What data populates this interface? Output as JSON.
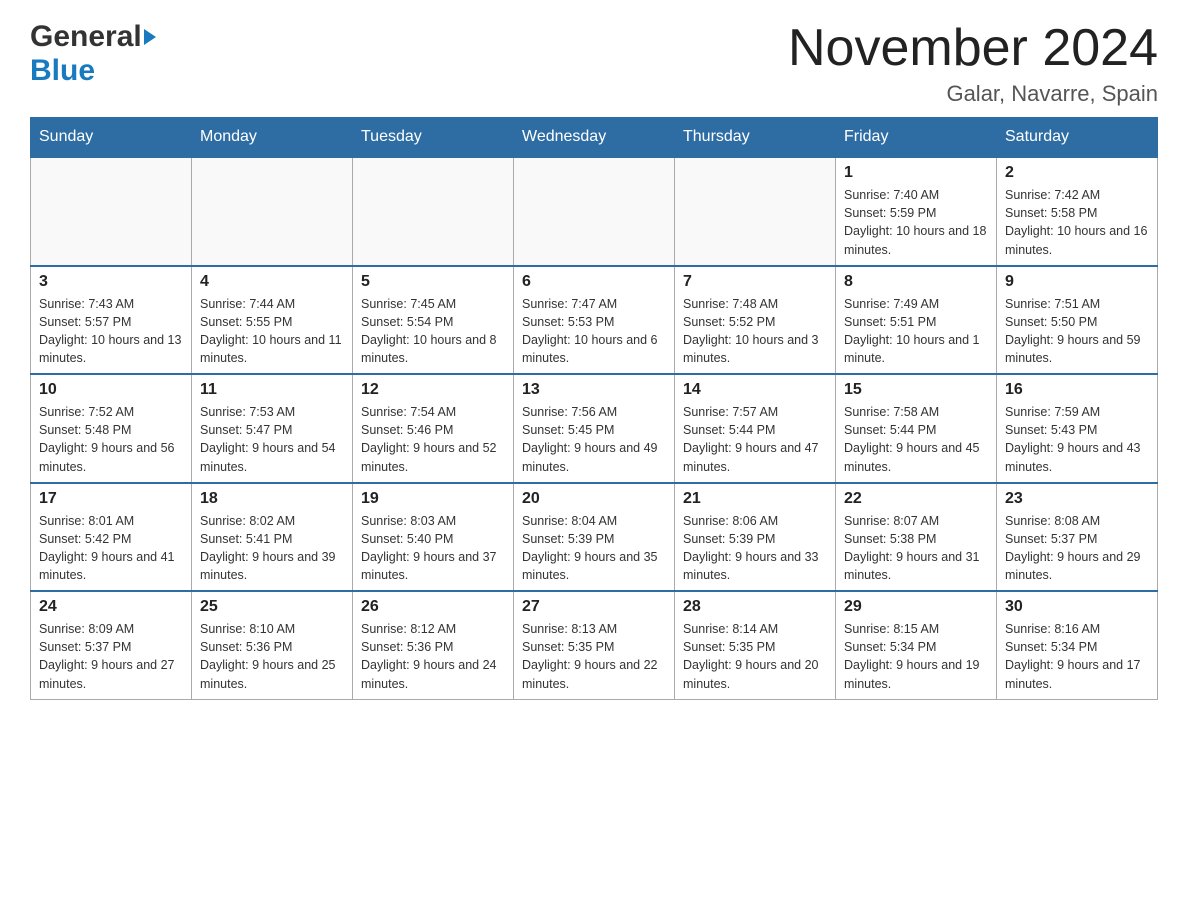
{
  "header": {
    "logo_general": "General",
    "logo_blue": "Blue",
    "month_title": "November 2024",
    "location": "Galar, Navarre, Spain"
  },
  "calendar": {
    "days_of_week": [
      "Sunday",
      "Monday",
      "Tuesday",
      "Wednesday",
      "Thursday",
      "Friday",
      "Saturday"
    ],
    "weeks": [
      {
        "days": [
          {
            "number": "",
            "info": ""
          },
          {
            "number": "",
            "info": ""
          },
          {
            "number": "",
            "info": ""
          },
          {
            "number": "",
            "info": ""
          },
          {
            "number": "",
            "info": ""
          },
          {
            "number": "1",
            "info": "Sunrise: 7:40 AM\nSunset: 5:59 PM\nDaylight: 10 hours and 18 minutes."
          },
          {
            "number": "2",
            "info": "Sunrise: 7:42 AM\nSunset: 5:58 PM\nDaylight: 10 hours and 16 minutes."
          }
        ]
      },
      {
        "days": [
          {
            "number": "3",
            "info": "Sunrise: 7:43 AM\nSunset: 5:57 PM\nDaylight: 10 hours and 13 minutes."
          },
          {
            "number": "4",
            "info": "Sunrise: 7:44 AM\nSunset: 5:55 PM\nDaylight: 10 hours and 11 minutes."
          },
          {
            "number": "5",
            "info": "Sunrise: 7:45 AM\nSunset: 5:54 PM\nDaylight: 10 hours and 8 minutes."
          },
          {
            "number": "6",
            "info": "Sunrise: 7:47 AM\nSunset: 5:53 PM\nDaylight: 10 hours and 6 minutes."
          },
          {
            "number": "7",
            "info": "Sunrise: 7:48 AM\nSunset: 5:52 PM\nDaylight: 10 hours and 3 minutes."
          },
          {
            "number": "8",
            "info": "Sunrise: 7:49 AM\nSunset: 5:51 PM\nDaylight: 10 hours and 1 minute."
          },
          {
            "number": "9",
            "info": "Sunrise: 7:51 AM\nSunset: 5:50 PM\nDaylight: 9 hours and 59 minutes."
          }
        ]
      },
      {
        "days": [
          {
            "number": "10",
            "info": "Sunrise: 7:52 AM\nSunset: 5:48 PM\nDaylight: 9 hours and 56 minutes."
          },
          {
            "number": "11",
            "info": "Sunrise: 7:53 AM\nSunset: 5:47 PM\nDaylight: 9 hours and 54 minutes."
          },
          {
            "number": "12",
            "info": "Sunrise: 7:54 AM\nSunset: 5:46 PM\nDaylight: 9 hours and 52 minutes."
          },
          {
            "number": "13",
            "info": "Sunrise: 7:56 AM\nSunset: 5:45 PM\nDaylight: 9 hours and 49 minutes."
          },
          {
            "number": "14",
            "info": "Sunrise: 7:57 AM\nSunset: 5:44 PM\nDaylight: 9 hours and 47 minutes."
          },
          {
            "number": "15",
            "info": "Sunrise: 7:58 AM\nSunset: 5:44 PM\nDaylight: 9 hours and 45 minutes."
          },
          {
            "number": "16",
            "info": "Sunrise: 7:59 AM\nSunset: 5:43 PM\nDaylight: 9 hours and 43 minutes."
          }
        ]
      },
      {
        "days": [
          {
            "number": "17",
            "info": "Sunrise: 8:01 AM\nSunset: 5:42 PM\nDaylight: 9 hours and 41 minutes."
          },
          {
            "number": "18",
            "info": "Sunrise: 8:02 AM\nSunset: 5:41 PM\nDaylight: 9 hours and 39 minutes."
          },
          {
            "number": "19",
            "info": "Sunrise: 8:03 AM\nSunset: 5:40 PM\nDaylight: 9 hours and 37 minutes."
          },
          {
            "number": "20",
            "info": "Sunrise: 8:04 AM\nSunset: 5:39 PM\nDaylight: 9 hours and 35 minutes."
          },
          {
            "number": "21",
            "info": "Sunrise: 8:06 AM\nSunset: 5:39 PM\nDaylight: 9 hours and 33 minutes."
          },
          {
            "number": "22",
            "info": "Sunrise: 8:07 AM\nSunset: 5:38 PM\nDaylight: 9 hours and 31 minutes."
          },
          {
            "number": "23",
            "info": "Sunrise: 8:08 AM\nSunset: 5:37 PM\nDaylight: 9 hours and 29 minutes."
          }
        ]
      },
      {
        "days": [
          {
            "number": "24",
            "info": "Sunrise: 8:09 AM\nSunset: 5:37 PM\nDaylight: 9 hours and 27 minutes."
          },
          {
            "number": "25",
            "info": "Sunrise: 8:10 AM\nSunset: 5:36 PM\nDaylight: 9 hours and 25 minutes."
          },
          {
            "number": "26",
            "info": "Sunrise: 8:12 AM\nSunset: 5:36 PM\nDaylight: 9 hours and 24 minutes."
          },
          {
            "number": "27",
            "info": "Sunrise: 8:13 AM\nSunset: 5:35 PM\nDaylight: 9 hours and 22 minutes."
          },
          {
            "number": "28",
            "info": "Sunrise: 8:14 AM\nSunset: 5:35 PM\nDaylight: 9 hours and 20 minutes."
          },
          {
            "number": "29",
            "info": "Sunrise: 8:15 AM\nSunset: 5:34 PM\nDaylight: 9 hours and 19 minutes."
          },
          {
            "number": "30",
            "info": "Sunrise: 8:16 AM\nSunset: 5:34 PM\nDaylight: 9 hours and 17 minutes."
          }
        ]
      }
    ]
  }
}
